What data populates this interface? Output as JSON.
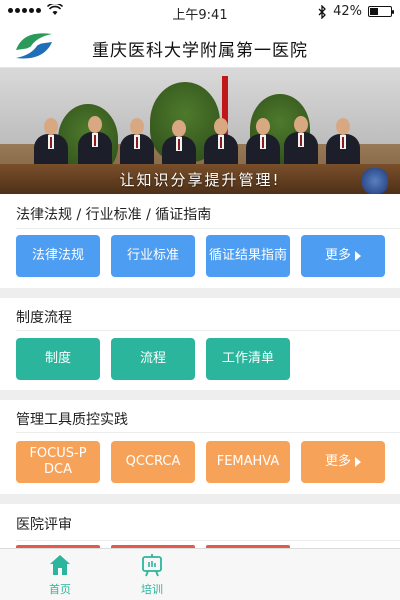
{
  "status_bar": {
    "time": "上午9:41",
    "battery": "42%",
    "battery_level": 0.42
  },
  "header": {
    "title": "重庆医科大学附属第一医院"
  },
  "banner": {
    "caption": "让知识分享提升管理!"
  },
  "sections": [
    {
      "title": "法律法规 / 行业标准 / 循证指南",
      "buttons": [
        "法律法规",
        "行业标准",
        "循证结果指南",
        "更多"
      ]
    },
    {
      "title": "制度流程",
      "buttons": [
        "制度",
        "流程",
        "工作清单"
      ]
    },
    {
      "title": "管理工具质控实践",
      "buttons": [
        "FOCUS-PDCA",
        "QCCRCA",
        "FEMAHVA",
        "更多"
      ]
    },
    {
      "title": "医院评审",
      "buttons": []
    }
  ],
  "tabbar": {
    "items": [
      {
        "label": "首页",
        "icon": "home-icon"
      },
      {
        "label": "培训",
        "icon": "training-icon"
      }
    ]
  },
  "colors": {
    "accent_green": "#2bb59c",
    "button_blue": "#4d9df2",
    "button_orange": "#f7a259"
  }
}
